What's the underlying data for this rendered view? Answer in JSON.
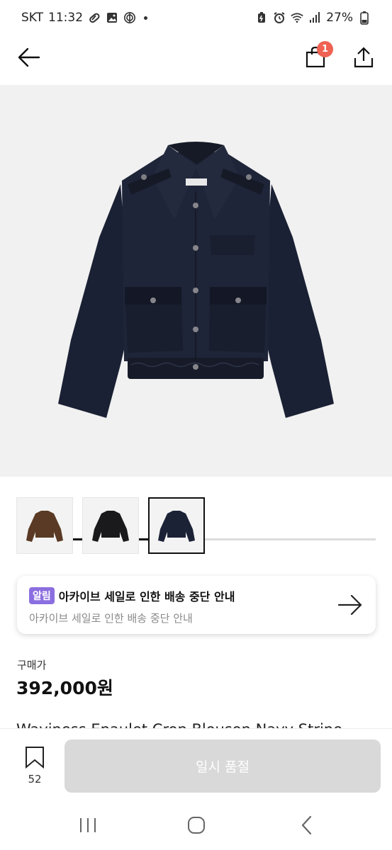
{
  "status_bar": {
    "carrier": "SKT",
    "time": "11:32",
    "battery": "27%"
  },
  "nav": {
    "cart_count": "1"
  },
  "gallery": {
    "progress": 0.5,
    "thumbnails": [
      {
        "color": "#5a3a24"
      },
      {
        "color": "#1a1a1c"
      },
      {
        "color": "#1c2236"
      }
    ],
    "selected_index": 2
  },
  "notice": {
    "badge": "알림",
    "title": "아카이브 세일로 인한 배송 중단 안내",
    "subtitle": "아카이브 세일로 인한 배송 중단 안내"
  },
  "price": {
    "label": "구매가",
    "value": "392,000원"
  },
  "product": {
    "name": "Waviness Epaulet Crop Blouson Navy Stripe"
  },
  "bottom": {
    "wish_count": "52",
    "soldout_label": "일시 품절"
  },
  "colors": {
    "badge": "#ef6253",
    "notice_badge": "#8b6ee0",
    "disabled_button": "#d9d9d9"
  }
}
